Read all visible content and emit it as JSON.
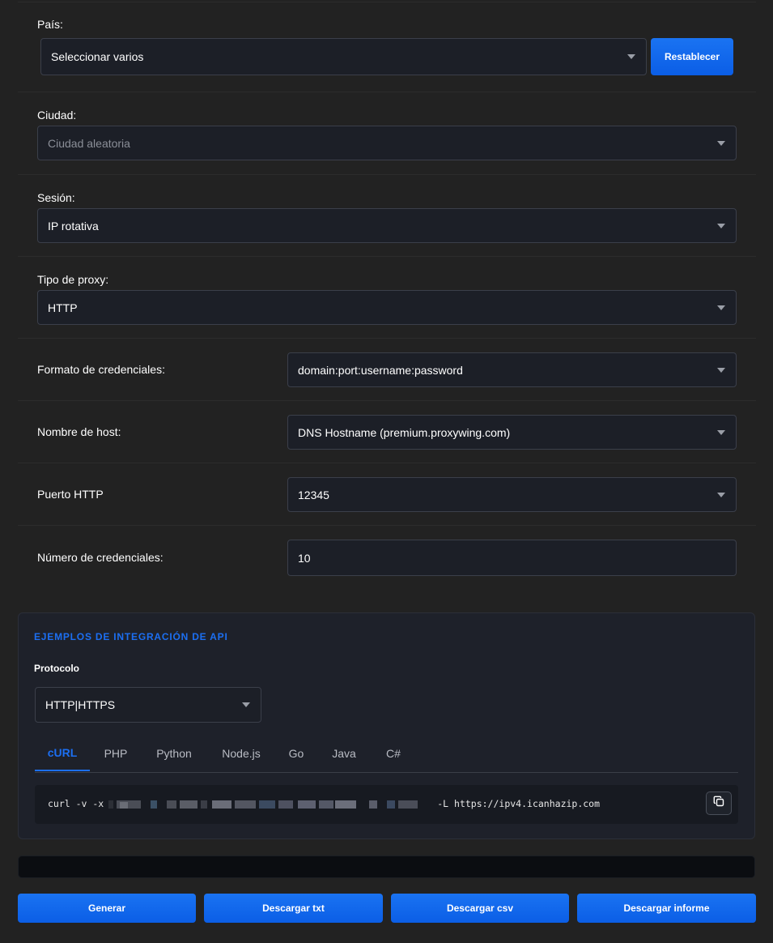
{
  "fields": {
    "country": {
      "label": "País:",
      "value": "Seleccionar varios",
      "reset_label": "Restablecer"
    },
    "city": {
      "label": "Ciudad:",
      "placeholder": "Ciudad aleatoria"
    },
    "session": {
      "label": "Sesión:",
      "value": "IP rotativa"
    },
    "proxy_type": {
      "label": "Tipo de proxy:",
      "value": "HTTP"
    },
    "credential_format": {
      "label": "Formato de credenciales:",
      "value": "domain:port:username:password"
    },
    "hostname": {
      "label": "Nombre de host:",
      "value": "DNS Hostname (premium.proxywing.com)"
    },
    "port": {
      "label": "Puerto HTTP",
      "value": "12345"
    },
    "credential_count": {
      "label": "Número de credenciales:",
      "value": "10"
    }
  },
  "api": {
    "title": "EJEMPLOS DE INTEGRACIÓN DE API",
    "protocol_label": "Protocolo",
    "protocol_value": "HTTP|HTTPS",
    "tabs": [
      "cURL",
      "PHP",
      "Python",
      "Node.js",
      "Go",
      "Java",
      "C#"
    ],
    "active_tab": "cURL",
    "code_prefix": "curl -v -x",
    "code_suffix": "-L https://ipv4.icanhazip.com"
  },
  "actions": {
    "generate": "Generar",
    "download_txt": "Descargar txt",
    "download_csv": "Descargar csv",
    "download_report": "Descargar informe"
  },
  "colors": {
    "background": "#222222",
    "accent": "#1c6ff2",
    "input_bg": "#1c1f27"
  }
}
